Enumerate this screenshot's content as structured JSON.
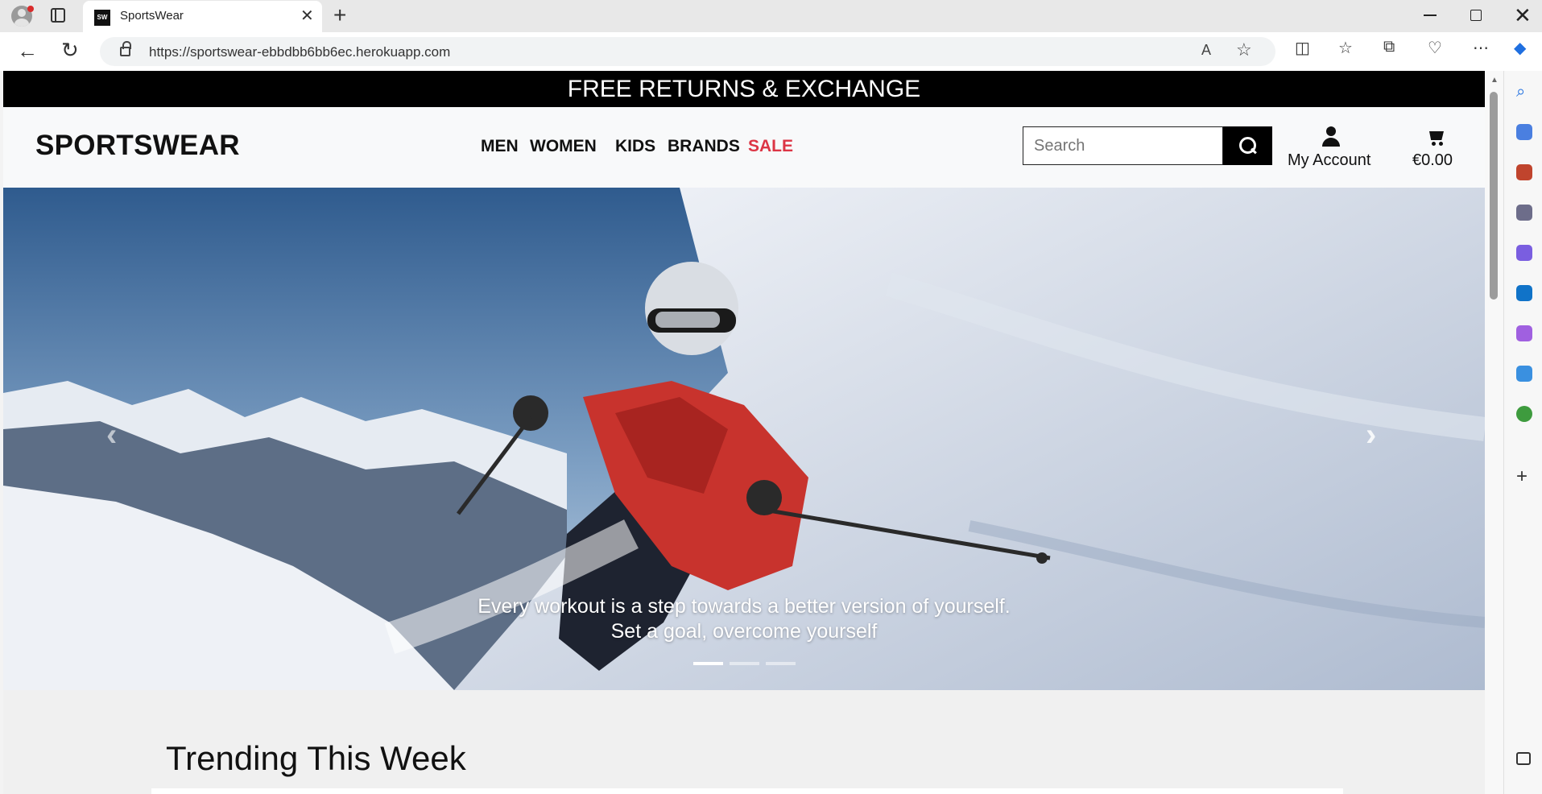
{
  "browser": {
    "tab_title": "SportsWear",
    "favicon_text": "SW",
    "url": "https://sportswear-ebbdbb6bb6ec.herokuapp.com"
  },
  "site": {
    "banner": "FREE RETURNS & EXCHANGE",
    "logo": "SPORTSWEAR",
    "menu": [
      {
        "label": "MEN"
      },
      {
        "label": "WOMEN"
      },
      {
        "label": "KIDS"
      },
      {
        "label": "BRANDS"
      },
      {
        "label": "SALE"
      }
    ],
    "search_placeholder": "Search",
    "account_label": "My Account",
    "cart_total": "€0.00",
    "colors": {
      "sale": "#dc3545",
      "banner": "#000000",
      "header": "#f8f9fa"
    }
  },
  "hero": {
    "caption_line1": "Every workout is a step towards a better version of yourself.",
    "caption_line2": "Set a goal, overcome yourself",
    "slide_count": 3,
    "active_slide": 1
  },
  "trending_title": "Trending This Week"
}
